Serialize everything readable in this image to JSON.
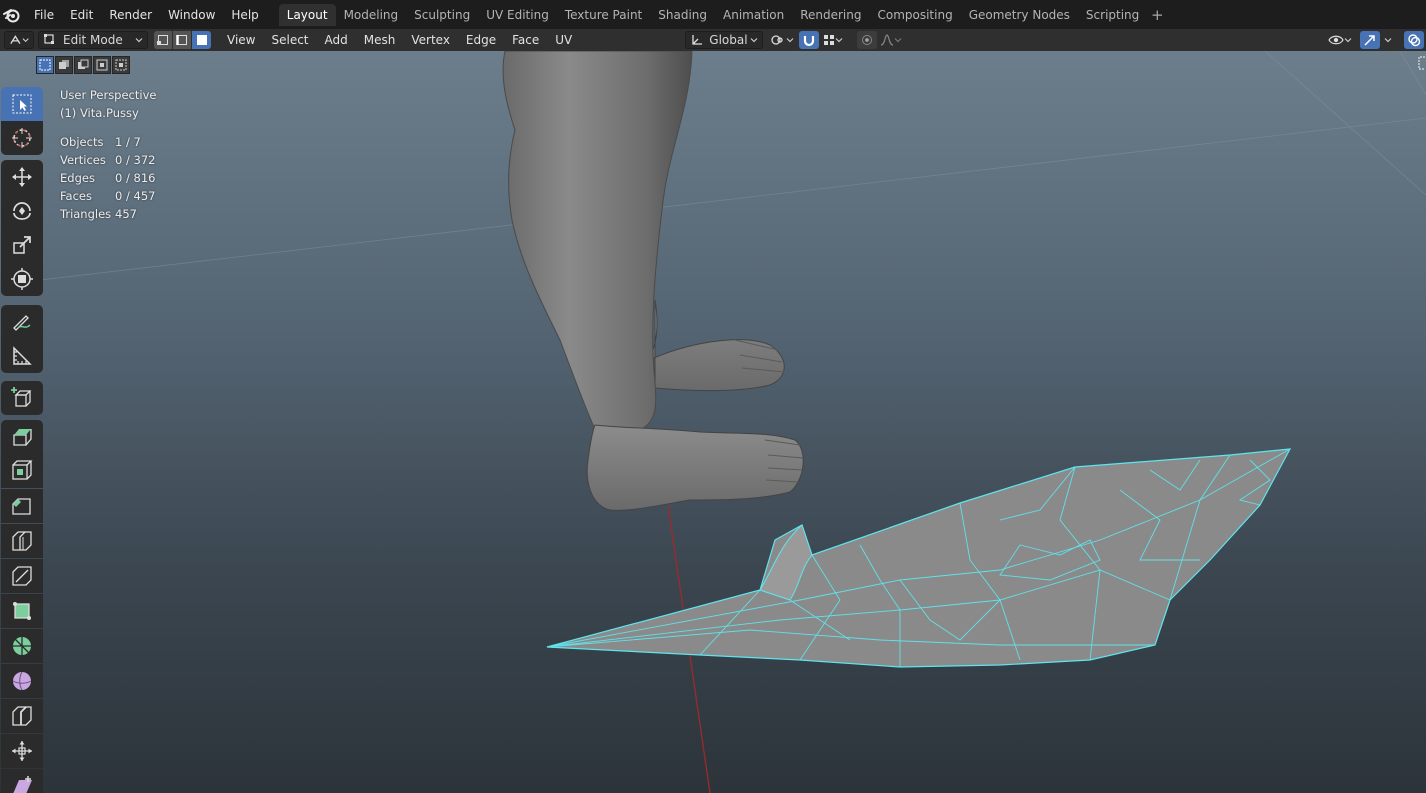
{
  "menubar": {
    "menus": [
      "File",
      "Edit",
      "Render",
      "Window",
      "Help"
    ],
    "workspaces": [
      {
        "label": "Layout",
        "active": true
      },
      {
        "label": "Modeling",
        "active": false
      },
      {
        "label": "Sculpting",
        "active": false
      },
      {
        "label": "UV Editing",
        "active": false
      },
      {
        "label": "Texture Paint",
        "active": false
      },
      {
        "label": "Shading",
        "active": false
      },
      {
        "label": "Animation",
        "active": false
      },
      {
        "label": "Rendering",
        "active": false
      },
      {
        "label": "Compositing",
        "active": false
      },
      {
        "label": "Geometry Nodes",
        "active": false
      },
      {
        "label": "Scripting",
        "active": false
      }
    ],
    "add_label": "+"
  },
  "header": {
    "mode": "Edit Mode",
    "menus": [
      "View",
      "Select",
      "Add",
      "Mesh",
      "Vertex",
      "Edge",
      "Face",
      "UV"
    ],
    "transform_orientation": "Global"
  },
  "viewport": {
    "view_name": "User Perspective",
    "object_name": "(1) Vita.Pussy",
    "stats": [
      {
        "label": "Objects",
        "value": "1 / 7"
      },
      {
        "label": "Vertices",
        "value": "0 / 372"
      },
      {
        "label": "Edges",
        "value": "0 / 816"
      },
      {
        "label": "Faces",
        "value": "0 / 457"
      },
      {
        "label": "Triangles",
        "value": "457"
      }
    ]
  },
  "colors": {
    "accent": "#4772b3",
    "wireframe": "#5ee6ee",
    "x_axis": "#9b2b2b"
  }
}
